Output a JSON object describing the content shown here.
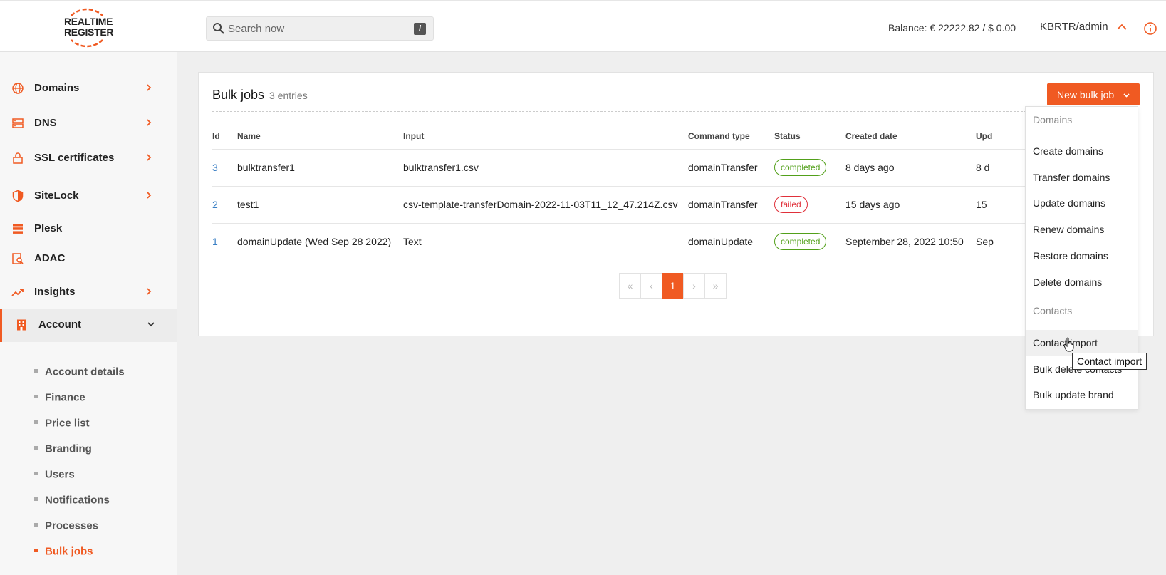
{
  "header": {
    "logo_line1": "REALTIME",
    "logo_line2": "REGISTER",
    "search_placeholder": "Search now",
    "search_shortcut": "/",
    "balance": "Balance: € 22222.82 / $ 0.00",
    "user": "KBRTR/admin"
  },
  "sidebar": {
    "items": [
      {
        "label": "Domains"
      },
      {
        "label": "DNS"
      },
      {
        "label": "SSL certificates"
      },
      {
        "label": "SiteLock"
      },
      {
        "label": "Plesk"
      },
      {
        "label": "ADAC"
      },
      {
        "label": "Insights"
      },
      {
        "label": "Account"
      }
    ],
    "account_sub": [
      {
        "label": "Account details"
      },
      {
        "label": "Finance"
      },
      {
        "label": "Price list"
      },
      {
        "label": "Branding"
      },
      {
        "label": "Users"
      },
      {
        "label": "Notifications"
      },
      {
        "label": "Processes"
      },
      {
        "label": "Bulk jobs"
      }
    ]
  },
  "main": {
    "title": "Bulk jobs",
    "count": "3 entries",
    "new_button": "New bulk job",
    "columns": [
      "Id",
      "Name",
      "Input",
      "Command type",
      "Status",
      "Created date",
      "Upd"
    ],
    "rows": [
      {
        "id": "3",
        "name": "bulktransfer1",
        "input": "bulktransfer1.csv",
        "command": "domainTransfer",
        "status": "completed",
        "created": "8 days ago",
        "updated": "8 d"
      },
      {
        "id": "2",
        "name": "test1",
        "input": "csv-template-transferDomain-2022-11-03T11_12_47.214Z.csv",
        "command": "domainTransfer",
        "status": "failed",
        "created": "15 days ago",
        "updated": "15"
      },
      {
        "id": "1",
        "name": "domainUpdate (Wed Sep 28 2022)",
        "input": "Text",
        "command": "domainUpdate",
        "status": "completed",
        "created": "September 28, 2022 10:50",
        "updated": "Sep"
      }
    ],
    "pager": {
      "first": "«",
      "prev": "‹",
      "page": "1",
      "next": "›",
      "last": "»"
    }
  },
  "dropdown": {
    "domains_header": "Domains",
    "domain_items": [
      "Create domains",
      "Transfer domains",
      "Update domains",
      "Renew domains",
      "Restore domains",
      "Delete domains"
    ],
    "contacts_header": "Contacts",
    "contact_items": [
      "Contact import",
      "Bulk delete contacts",
      "Bulk update brand"
    ],
    "tooltip": "Contact import"
  },
  "colors": {
    "accent": "#f05a22",
    "completed": "#52a01a",
    "failed": "#e0303a",
    "link": "#3a7fc4"
  }
}
